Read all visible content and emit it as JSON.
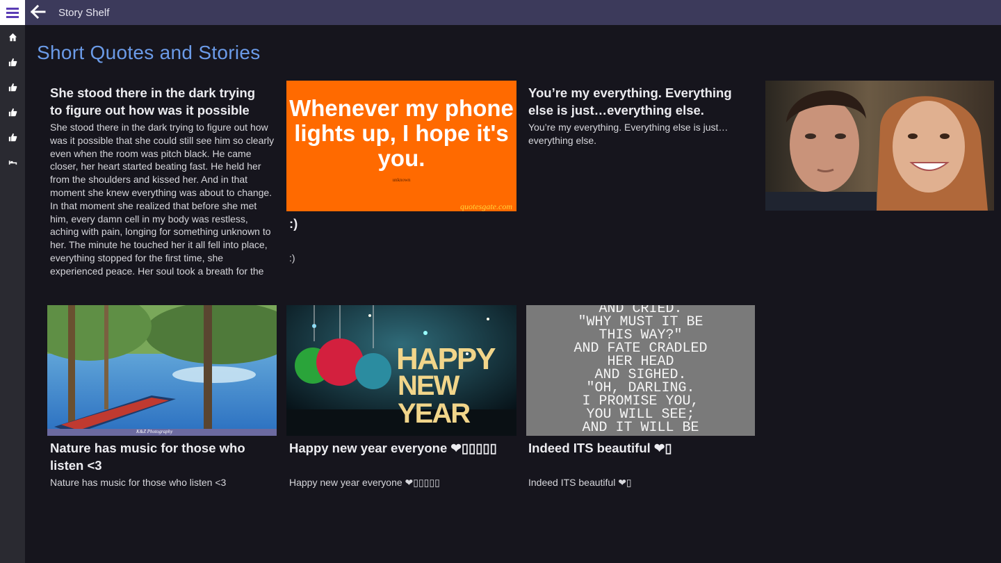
{
  "app": {
    "title": "Story Shelf"
  },
  "nav": {
    "rail": [
      {
        "icon": "home-icon"
      },
      {
        "icon": "thumbs-up-icon"
      },
      {
        "icon": "thumbs-up-icon"
      },
      {
        "icon": "thumbs-up-icon"
      },
      {
        "icon": "thumbs-up-icon"
      },
      {
        "icon": "bed-icon"
      }
    ]
  },
  "page": {
    "title": "Short Quotes and Stories"
  },
  "cards": [
    {
      "title": "She stood there in the dark trying to figure out how was it possible",
      "body": "She stood there in the dark trying to figure out how was it possible that she could still see him so clearly even when the room was pitch black. He came closer, her heart started beating fast. He held her from the shoulders and kissed her. And in that moment she knew everything was about to change. In that moment she realized that before she met him, every damn cell in my body was restless, aching with pain, longing for something unknown to her. The minute he touched her it all fell into place, everything stopped for the first time, she experienced peace. Her soul took a breath for the first time in a very long while."
    },
    {
      "image_text": "Whenever my phone lights up, I hope it's you.",
      "image_author": "unknown",
      "image_watermark": "quotesgate.com",
      "title": ":)",
      "body": ":)"
    },
    {
      "title": "You’re my everything. Everything else is just…everything else.",
      "body": "You’re my everything. Everything else is just…everything else."
    },
    {
      "image_alt": "couple photo"
    },
    {
      "image_watermark": "K&Z Photography",
      "title": "Nature has music for those who listen <3",
      "body": "Nature has music for those who listen <3"
    },
    {
      "image_text_1": "HAPPY",
      "image_text_2": "NEW YEAR",
      "title": "Happy new year everyone ❤▯▯▯▯▯",
      "body": "Happy new year everyone ❤▯▯▯▯▯"
    },
    {
      "image_lines": [
        "AND CRIED.",
        "\"WHY MUST IT BE",
        "THIS WAY?\"",
        "AND FATE CRADLED",
        "HER HEAD",
        "AND SIGHED.",
        "\"OH, DARLING.",
        "I PROMISE YOU,",
        "YOU WILL SEE;",
        "AND IT WILL BE"
      ],
      "title": "Indeed ITS beautiful ❤▯",
      "body": "Indeed ITS beautiful ❤▯"
    }
  ],
  "colors": {
    "titlebar": "#3c3a5b",
    "rail": "#2a2a31",
    "background": "#16151d",
    "heading": "#6b9be8",
    "accent_orange": "#ff6a00"
  }
}
